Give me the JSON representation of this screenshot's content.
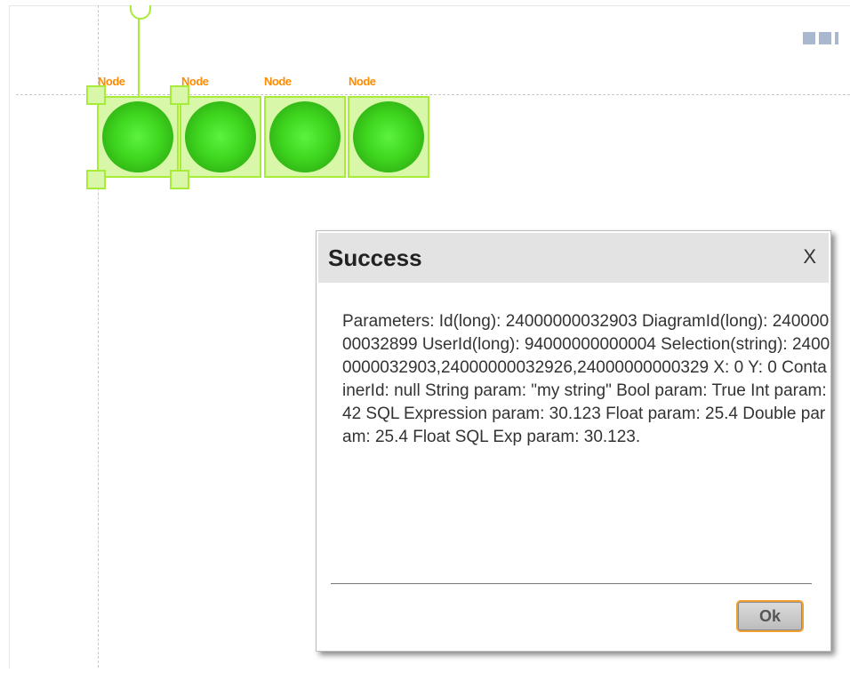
{
  "canvas": {
    "node_labels": [
      "Node",
      "Node",
      "Node",
      "Node"
    ]
  },
  "dialog": {
    "title": "Success",
    "close_label": "X",
    "message": "Parameters: Id(long): 24000000032903 DiagramId(long): 24000000032899 UserId(long): 94000000000004 Selection(string): 24000000032903,24000000032926,24000000000329 X: 0 Y: 0 ContainerId: null String param: \"my string\" Bool param: True Int param: 42 SQL Expression param: 30.123 Float param: 25.4 Double param: 25.4 Float SQL Exp param: 30.123.",
    "ok_label": "Ok"
  },
  "colors": {
    "node_fill": "#3fd61f",
    "selection": "#a8ec3a",
    "label": "#ff8c00",
    "ok_border": "#f0a030"
  }
}
